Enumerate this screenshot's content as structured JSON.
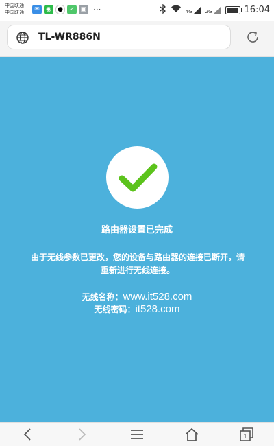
{
  "status_bar": {
    "carrier_1": "中国联通",
    "carrier_2": "中国联通",
    "more": "···",
    "network_1": "4G",
    "network_2": "2G",
    "battery_level": 0.8,
    "time": "16:04"
  },
  "browser": {
    "url": "TL-WR886N"
  },
  "message": {
    "title": "路由器设置已完成",
    "body": "由于无线参数已更改，您的设备与路由器的连接已断开，请重新进行无线连接。",
    "ssid_label": "无线名称：",
    "ssid_value": "www.it528.com",
    "password_label": "无线密码：",
    "password_value": "it528.com"
  },
  "colors": {
    "background": "#4cb1dc",
    "check": "#5cc31c"
  }
}
